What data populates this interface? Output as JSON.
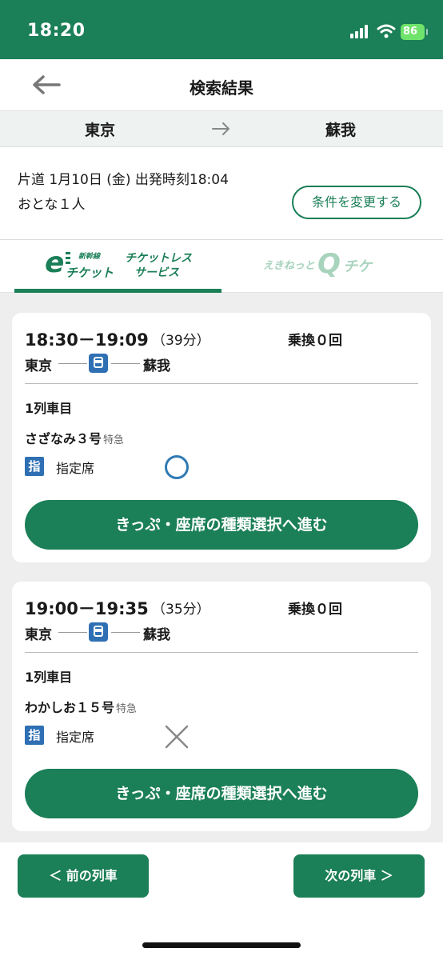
{
  "status": {
    "time": "18:20",
    "battery": "86"
  },
  "header": {
    "title": "検索結果"
  },
  "route": {
    "from": "東京",
    "to": "蘇我"
  },
  "conditions": {
    "line1": "片道 1月10日 (金) 出発時刻18:04",
    "line2": "おとな１人",
    "change_button": "条件を変更する"
  },
  "tabs": [
    {
      "logo_main": "チケット",
      "logo_small": "新幹線",
      "logo_sub1": "チケットレス",
      "logo_sub2": "サービス",
      "active": true
    },
    {
      "logo_left": "えきねっと",
      "logo_right": "チケ",
      "active": false
    }
  ],
  "results": [
    {
      "times": "18:30－19:09",
      "duration": "（39分）",
      "transfers": "乗換０回",
      "from": "東京",
      "to": "蘇我",
      "car_label": "1列車目",
      "train_name": "さざなみ３号",
      "train_type": "特急",
      "seat_badge": "指",
      "seat_type": "指定席",
      "availability": "available",
      "button": "きっぷ・座席の種類選択へ進む"
    },
    {
      "times": "19:00－19:35",
      "duration": "（35分）",
      "transfers": "乗換０回",
      "from": "東京",
      "to": "蘇我",
      "car_label": "1列車目",
      "train_name": "わかしお１５号",
      "train_type": "特急",
      "seat_badge": "指",
      "seat_type": "指定席",
      "availability": "unavailable",
      "button": "きっぷ・座席の種類選択へ進む"
    }
  ],
  "footer": {
    "prev": "＜ 前の列車",
    "next": "次の列車 ＞"
  },
  "colors": {
    "brand_green": "#1b7f57",
    "badge_blue": "#2f6fb3"
  }
}
